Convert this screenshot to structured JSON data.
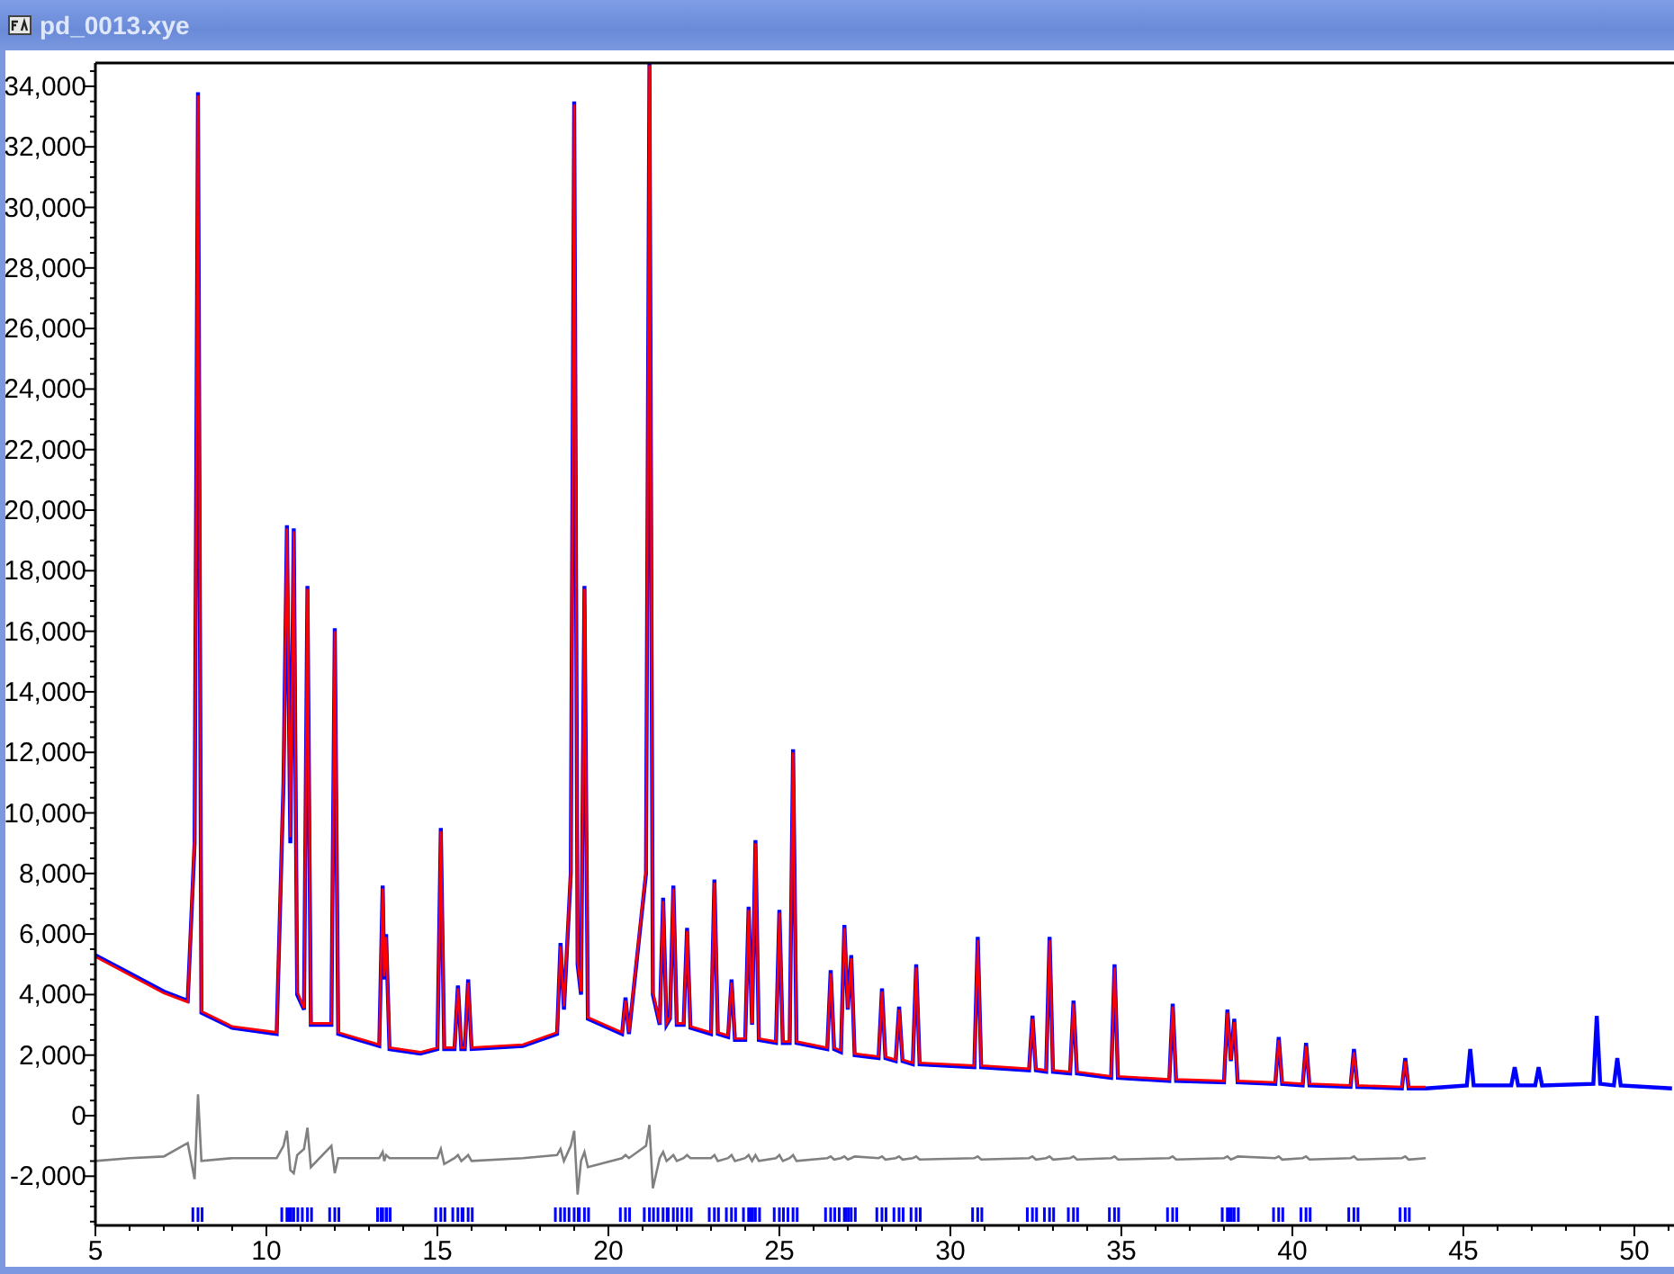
{
  "window": {
    "title": "pd_0013.xye"
  },
  "chart_data": {
    "type": "line",
    "x": [
      5,
      6,
      7,
      7.7,
      7.9,
      8.0,
      8.1,
      9,
      10.3,
      10.5,
      10.6,
      10.7,
      10.8,
      10.9,
      11.1,
      11.2,
      11.3,
      11.9,
      12.0,
      12.1,
      13.3,
      13.4,
      13.45,
      13.5,
      13.6,
      14.5,
      15.0,
      15.1,
      15.2,
      15.5,
      15.6,
      15.7,
      15.8,
      15.9,
      16.0,
      17.5,
      18.5,
      18.6,
      18.7,
      18.9,
      19.0,
      19.1,
      19.2,
      19.3,
      19.4,
      20.4,
      20.5,
      20.6,
      21.1,
      21.2,
      21.3,
      21.5,
      21.6,
      21.7,
      21.8,
      21.9,
      22.0,
      22.2,
      22.3,
      22.4,
      23.0,
      23.1,
      23.2,
      23.5,
      23.6,
      23.7,
      24.0,
      24.1,
      24.2,
      24.3,
      24.4,
      24.9,
      25.0,
      25.1,
      25.3,
      25.4,
      25.5,
      26.4,
      26.5,
      26.6,
      26.8,
      26.9,
      27.0,
      27.1,
      27.2,
      27.9,
      28.0,
      28.1,
      28.4,
      28.5,
      28.6,
      28.9,
      29.0,
      29.1,
      30.7,
      30.8,
      30.9,
      32.3,
      32.4,
      32.5,
      32.8,
      32.9,
      33.0,
      33.5,
      33.6,
      33.7,
      34.7,
      34.8,
      34.9,
      36.4,
      36.5,
      36.6,
      38.0,
      38.1,
      38.2,
      38.3,
      38.4,
      39.5,
      39.6,
      39.7,
      40.3,
      40.4,
      40.5,
      41.7,
      41.8,
      41.9,
      43.2,
      43.3,
      43.4,
      43.9,
      45.1,
      45.2,
      45.3,
      46.4,
      46.5,
      46.6,
      47.1,
      47.2,
      47.3,
      48.8,
      48.9,
      49.0,
      49.4,
      49.5,
      49.6,
      51.1
    ],
    "series": [
      {
        "color": "#0000ff",
        "values": [
          5300,
          4700,
          4100,
          3800,
          9000,
          33800,
          3400,
          2900,
          2700,
          11000,
          19500,
          9000,
          19400,
          4000,
          3500,
          17500,
          3000,
          3000,
          16100,
          2700,
          2300,
          7600,
          4500,
          6000,
          2200,
          2050,
          2200,
          9500,
          2200,
          2200,
          4300,
          2200,
          2200,
          4500,
          2200,
          2300,
          2700,
          5700,
          3500,
          8000,
          33500,
          5000,
          4000,
          17500,
          3200,
          2700,
          3900,
          2700,
          8000,
          34760,
          4000,
          3000,
          7200,
          3000,
          3200,
          7600,
          3000,
          3000,
          6200,
          2900,
          2700,
          7800,
          2700,
          2600,
          4500,
          2500,
          2500,
          6900,
          3000,
          9100,
          2500,
          2400,
          6800,
          2400,
          2400,
          12100,
          2400,
          2200,
          4800,
          2200,
          2100,
          6300,
          3500,
          5300,
          2000,
          1900,
          4200,
          1900,
          1800,
          3600,
          1800,
          1700,
          5000,
          1700,
          1600,
          5900,
          1600,
          1500,
          3300,
          1500,
          1450,
          5900,
          1450,
          1400,
          3800,
          1400,
          1250,
          5000,
          1250,
          1150,
          3700,
          1150,
          1100,
          3500,
          1800,
          3200,
          1100,
          1050,
          2600,
          1050,
          1000,
          2400,
          1000,
          950,
          2200,
          950,
          900,
          1900,
          900,
          900,
          1000,
          2200,
          1000,
          1000,
          1600,
          1000,
          1000,
          1600,
          1000,
          1050,
          3300,
          1050,
          1000,
          1900,
          1000,
          900
        ]
      },
      {
        "color": "#ff0000",
        "values": [
          5250,
          4650,
          4050,
          3750,
          9200,
          33700,
          3450,
          2950,
          2750,
          11200,
          19400,
          9200,
          19300,
          4100,
          3550,
          17400,
          3050,
          3050,
          16000,
          2750,
          2350,
          7500,
          4600,
          5900,
          2250,
          2100,
          2250,
          9400,
          2250,
          2250,
          4200,
          2250,
          2250,
          4400,
          2250,
          2350,
          2750,
          5600,
          3600,
          8100,
          33400,
          5100,
          4100,
          17400,
          3250,
          2750,
          3800,
          2750,
          8100,
          34700,
          4100,
          3050,
          7100,
          3050,
          3250,
          7500,
          3050,
          3050,
          6100,
          2950,
          2750,
          7700,
          2750,
          2650,
          4400,
          2550,
          2550,
          6800,
          3050,
          9000,
          2550,
          2450,
          6700,
          2450,
          2450,
          12000,
          2450,
          2250,
          4700,
          2250,
          2150,
          6200,
          3550,
          5200,
          2050,
          1950,
          4100,
          1950,
          1850,
          3500,
          1850,
          1750,
          4900,
          1750,
          1650,
          5800,
          1650,
          1550,
          3200,
          1550,
          1500,
          5800,
          1500,
          1450,
          3700,
          1450,
          1300,
          4900,
          1300,
          1200,
          3600,
          1200,
          1150,
          3400,
          1850,
          3100,
          1150,
          1100,
          2500,
          1100,
          1050,
          2300,
          1050,
          1000,
          2100,
          1000,
          950,
          1800,
          950,
          950,
          null,
          null,
          null,
          null,
          null,
          null,
          null,
          null,
          null,
          null,
          null,
          null,
          null,
          null,
          null,
          null
        ]
      },
      {
        "color": "#808080",
        "values": [
          -1500,
          -1400,
          -1350,
          -900,
          -2100,
          700,
          -1500,
          -1400,
          -1400,
          -1000,
          -500,
          -1800,
          -1900,
          -1300,
          -1100,
          -400,
          -1700,
          -1000,
          -1900,
          -1400,
          -1400,
          -1200,
          -1500,
          -1300,
          -1400,
          -1400,
          -1400,
          -1100,
          -1600,
          -1400,
          -1300,
          -1500,
          -1400,
          -1300,
          -1500,
          -1400,
          -1300,
          -1100,
          -1500,
          -1000,
          -500,
          -2600,
          -1500,
          -1200,
          -1700,
          -1400,
          -1300,
          -1400,
          -1000,
          -300,
          -2400,
          -1400,
          -1200,
          -1500,
          -1400,
          -1300,
          -1500,
          -1400,
          -1300,
          -1400,
          -1400,
          -1300,
          -1500,
          -1400,
          -1300,
          -1500,
          -1400,
          -1300,
          -1500,
          -1300,
          -1500,
          -1400,
          -1300,
          -1500,
          -1400,
          -1300,
          -1500,
          -1400,
          -1350,
          -1450,
          -1400,
          -1350,
          -1450,
          -1400,
          -1350,
          -1400,
          -1350,
          -1450,
          -1400,
          -1350,
          -1450,
          -1400,
          -1350,
          -1450,
          -1400,
          -1350,
          -1450,
          -1400,
          -1350,
          -1450,
          -1400,
          -1350,
          -1450,
          -1400,
          -1350,
          -1450,
          -1400,
          -1350,
          -1450,
          -1400,
          -1350,
          -1450,
          -1400,
          -1350,
          -1450,
          -1400,
          -1350,
          -1400,
          -1350,
          -1450,
          -1400,
          -1350,
          -1450,
          -1400,
          -1350,
          -1450,
          -1400,
          -1350,
          -1450,
          -1400,
          null,
          null,
          null,
          null,
          null,
          null,
          null,
          null,
          null,
          null,
          null,
          null,
          null,
          null,
          null,
          null
        ]
      }
    ],
    "xlim": [
      5,
      51.16
    ],
    "ylim": [
      -3625,
      34770
    ],
    "xticks": [
      5,
      10,
      15,
      20,
      25,
      30,
      35,
      40,
      45,
      50
    ],
    "yticks": [
      {
        "value": -2000,
        "label": "-2,000"
      },
      {
        "value": 0,
        "label": "0"
      },
      {
        "value": 2000,
        "label": "2,000"
      },
      {
        "value": 4000,
        "label": "4,000"
      },
      {
        "value": 6000,
        "label": "6,000"
      },
      {
        "value": 8000,
        "label": "8,000"
      },
      {
        "value": 10000,
        "label": "10,000"
      },
      {
        "value": 12000,
        "label": "12,000"
      },
      {
        "value": 14000,
        "label": "14,000"
      },
      {
        "value": 16000,
        "label": "16,000"
      },
      {
        "value": 18000,
        "label": "18,000"
      },
      {
        "value": 20000,
        "label": "20,000"
      },
      {
        "value": 22000,
        "label": "22,000"
      },
      {
        "value": 24000,
        "label": "24,000"
      },
      {
        "value": 26000,
        "label": "26,000"
      },
      {
        "value": 28000,
        "label": "28,000"
      },
      {
        "value": 30000,
        "label": "30,000"
      },
      {
        "value": 32000,
        "label": "32,000"
      },
      {
        "value": 34000,
        "label": "34,000"
      }
    ]
  }
}
